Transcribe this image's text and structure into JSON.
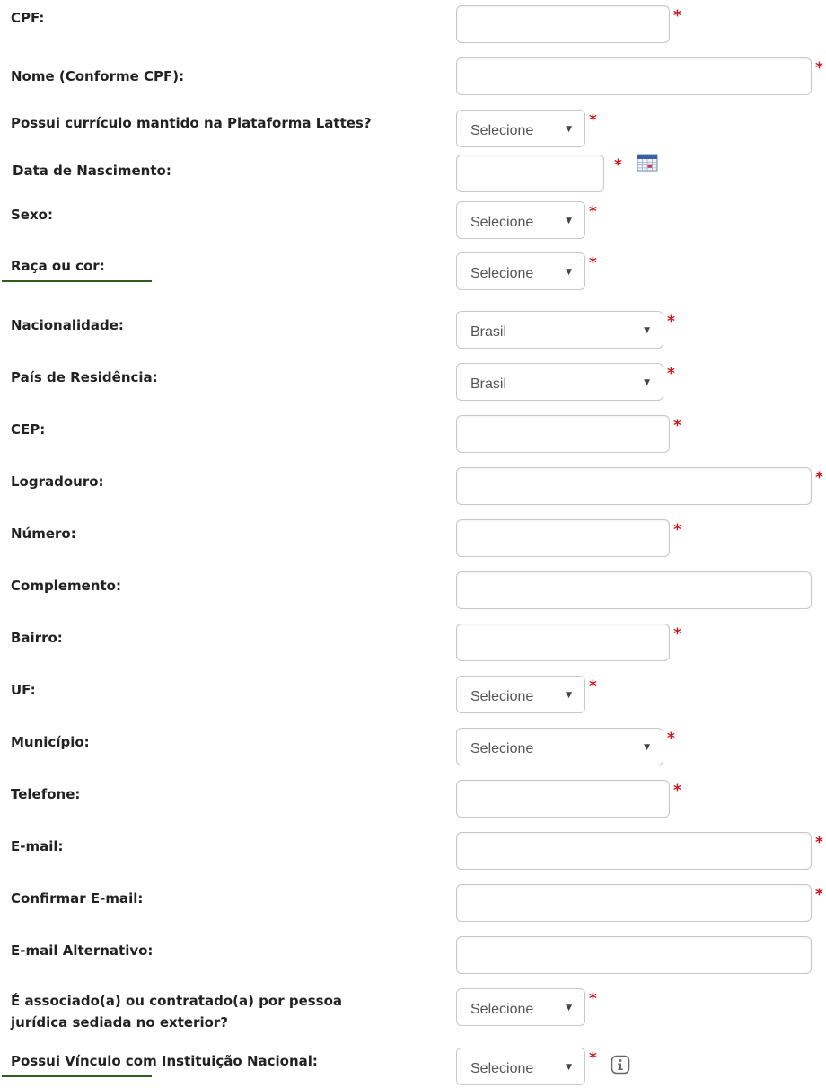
{
  "required_marker": "*",
  "colors": {
    "required": "#d0161a",
    "underline": "#2f5d1f"
  },
  "fields": {
    "cpf": {
      "label": "CPF:",
      "value": ""
    },
    "nome": {
      "label": "Nome (Conforme CPF):",
      "value": ""
    },
    "lattes": {
      "label": "Possui currículo mantido na Plataforma Lattes?",
      "selected": "Selecione"
    },
    "nascimento": {
      "label": "Data de Nascimento:",
      "value": "",
      "icon": "calendar-icon"
    },
    "sexo": {
      "label": "Sexo:",
      "selected": "Selecione"
    },
    "raca": {
      "label": "Raça ou cor:",
      "selected": "Selecione"
    },
    "nacionalidade": {
      "label": "Nacionalidade:",
      "selected": "Brasil"
    },
    "pais": {
      "label": "País de Residência:",
      "selected": "Brasil"
    },
    "cep": {
      "label": "CEP:",
      "value": ""
    },
    "logradouro": {
      "label": "Logradouro:",
      "value": ""
    },
    "numero": {
      "label": "Número:",
      "value": ""
    },
    "complemento": {
      "label": "Complemento:",
      "value": ""
    },
    "bairro": {
      "label": "Bairro:",
      "value": ""
    },
    "uf": {
      "label": "UF:",
      "selected": "Selecione"
    },
    "municipio": {
      "label": "Município:",
      "selected": "Selecione"
    },
    "telefone": {
      "label": "Telefone:",
      "value": ""
    },
    "email": {
      "label": "E-mail:",
      "value": ""
    },
    "confirmar_email": {
      "label": "Confirmar E-mail:",
      "value": ""
    },
    "email_alt": {
      "label": "E-mail Alternativo:",
      "value": ""
    },
    "exterior": {
      "label_line1": "É associado(a) ou contratado(a) por pessoa",
      "label_line2": "jurídica sediada no exterior?",
      "selected": "Selecione"
    },
    "vinculo": {
      "label": "Possui Vínculo com Instituição Nacional:",
      "selected": "Selecione",
      "icon": "info-icon"
    }
  }
}
